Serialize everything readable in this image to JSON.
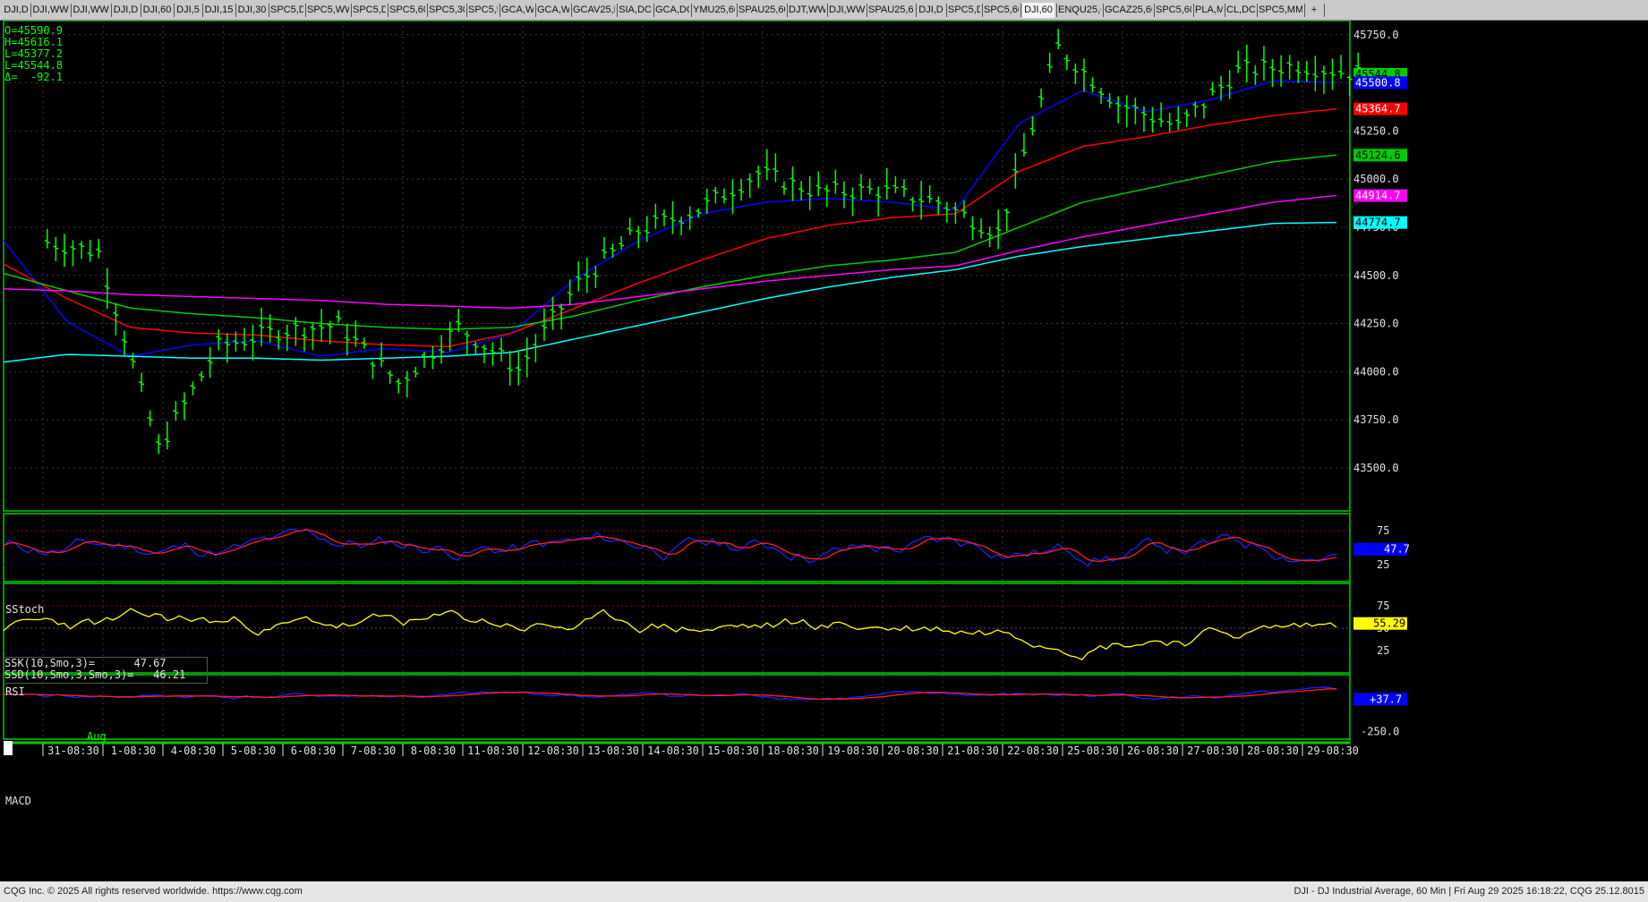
{
  "tabs": [
    {
      "label": "DJI,D"
    },
    {
      "label": "DJI,WW"
    },
    {
      "label": "DJI,WW"
    },
    {
      "label": "DJI,D"
    },
    {
      "label": "DJI,60"
    },
    {
      "label": "DJI,5"
    },
    {
      "label": "DJI,15"
    },
    {
      "label": "DJI,30"
    },
    {
      "label": "SPC5,D"
    },
    {
      "label": "SPC5,WW"
    },
    {
      "label": "SPC5,D"
    },
    {
      "label": "SPC5,60"
    },
    {
      "label": "SPC5,30"
    },
    {
      "label": "SPC5,5"
    },
    {
      "label": "GCA,W"
    },
    {
      "label": "GCA,W"
    },
    {
      "label": "GCAV25,D"
    },
    {
      "label": "SIA,DC"
    },
    {
      "label": "GCA,DC"
    },
    {
      "label": "YMU25,60"
    },
    {
      "label": "SPAU25,60"
    },
    {
      "label": "DJT,WW"
    },
    {
      "label": "DJI,WW"
    },
    {
      "label": "SPAU25,60"
    },
    {
      "label": "DJI,D"
    },
    {
      "label": "SPC5,D"
    },
    {
      "label": "SPC5,60"
    },
    {
      "label": "DJI,60",
      "active": true
    },
    {
      "label": "ENQU25,60"
    },
    {
      "label": "GCAZ25,60"
    },
    {
      "label": "SPC5,60"
    },
    {
      "label": "PLA,M"
    },
    {
      "label": "CL,DC"
    },
    {
      "label": "SPC5,MM"
    },
    {
      "label": "+"
    }
  ],
  "info": {
    "open": "O=45590.9",
    "high": "H=45616.1",
    "low": "L=45377.2",
    "last": "L=45544.8",
    "delta": "Δ=  -92.1"
  },
  "price_axis": {
    "labels": [
      "45750.0",
      "45500.0",
      "45250.0",
      "45000.0",
      "44750.0",
      "44500.0",
      "44250.0",
      "44000.0",
      "43750.0",
      "43500.0"
    ]
  },
  "price_badges": [
    {
      "text": "45544.8",
      "bg": "#00cc00",
      "fg": "#000000"
    },
    {
      "text": "45500.8",
      "bg": "#0000ff",
      "fg": "#ffffff"
    },
    {
      "text": "45364.7",
      "bg": "#ff0000",
      "fg": "#ffffff"
    },
    {
      "text": "45124.6",
      "bg": "#00cc00",
      "fg": "#000000"
    },
    {
      "text": "44914.7",
      "bg": "#ff00ff",
      "fg": "#ffffff"
    },
    {
      "text": "44774.7",
      "bg": "#00ffff",
      "fg": "#000000"
    }
  ],
  "stoch": {
    "title": "SStoch",
    "ssk": "SSK(10,Smo,3)=      47.67",
    "ssd": "SSD(10,Smo,3,Smo,3)=   46.21",
    "axis": [
      "75",
      "25"
    ],
    "badge": "47.7"
  },
  "rsi": {
    "title": "RSI",
    "axis": [
      "75",
      "50",
      "25"
    ],
    "badge": "55.29"
  },
  "macd": {
    "title": "MACD",
    "axis": [
      "-250.0"
    ],
    "badge": "+37.7"
  },
  "time_axis": {
    "month_label": "Aug",
    "labels": [
      "31-08:30",
      "1-08:30",
      "4-08:30",
      "5-08:30",
      "6-08:30",
      "7-08:30",
      "8-08:30",
      "11-08:30",
      "12-08:30",
      "13-08:30",
      "14-08:30",
      "15-08:30",
      "18-08:30",
      "19-08:30",
      "20-08:30",
      "21-08:30",
      "22-08:30",
      "25-08:30",
      "26-08:30",
      "27-08:30",
      "28-08:30",
      "29-08:30"
    ]
  },
  "footer": {
    "left": "CQG Inc. © 2025 All rights reserved worldwide. https://www.cqg.com",
    "right": "DJI - DJ Industrial Average, 60 Min | Fri Aug 29 2025 16:18:22, CQG 25.12.8015"
  },
  "colors": {
    "bars": "#00ff00",
    "ma_fast": "#0000ff",
    "ma_2": "#ff0000",
    "ma_3": "#00cc00",
    "ma_4": "#ff00ff",
    "ma_5": "#00ffff",
    "rsi": "#ffff00",
    "grid": "#3a3a3a",
    "panel_border": "#00cc00"
  },
  "chart_data": {
    "type": "line",
    "title": "",
    "xlabel": "",
    "ylabel": "",
    "ylim": [
      43300,
      45800
    ],
    "categories": [
      "31-08:30",
      "1-08:30",
      "4-08:30",
      "5-08:30",
      "6-08:30",
      "7-08:30",
      "8-08:30",
      "11-08:30",
      "12-08:30",
      "13-08:30",
      "14-08:30",
      "15-08:30",
      "18-08:30",
      "19-08:30",
      "20-08:30",
      "21-08:30",
      "22-08:30",
      "25-08:30",
      "26-08:30",
      "27-08:30",
      "28-08:30",
      "29-08:30"
    ],
    "series": [
      {
        "values": [
          44620,
          43600,
          44130,
          44210,
          44240,
          43940,
          44230,
          44010,
          44460,
          44730,
          44840,
          45030,
          44930,
          44940,
          44880,
          44720,
          45680,
          45390,
          45270,
          45560,
          45590,
          45545
        ]
      },
      {
        "values": [
          44680,
          44260,
          44080,
          44140,
          44160,
          44080,
          44120,
          44100,
          44200,
          44480,
          44680,
          44820,
          44880,
          44900,
          44880,
          44840,
          45290,
          45460,
          45350,
          45410,
          45510,
          45501
        ]
      },
      {
        "values": [
          44560,
          44380,
          44230,
          44200,
          44190,
          44160,
          44140,
          44130,
          44200,
          44330,
          44460,
          44580,
          44690,
          44760,
          44800,
          44820,
          45040,
          45170,
          45220,
          45280,
          45330,
          45365
        ]
      },
      {
        "values": [
          44510,
          44420,
          44330,
          44300,
          44280,
          44250,
          44230,
          44220,
          44230,
          44290,
          44370,
          44440,
          44500,
          44550,
          44580,
          44620,
          44750,
          44880,
          44950,
          45020,
          45090,
          45125
        ]
      },
      {
        "values": [
          44430,
          44420,
          44400,
          44390,
          44380,
          44370,
          44350,
          44340,
          44330,
          44350,
          44390,
          44430,
          44470,
          44500,
          44530,
          44550,
          44630,
          44700,
          44760,
          44820,
          44880,
          44915
        ]
      },
      {
        "values": [
          44050,
          44090,
          44080,
          44070,
          44070,
          44060,
          44070,
          44080,
          44100,
          44170,
          44240,
          44310,
          44380,
          44440,
          44490,
          44530,
          44600,
          44650,
          44690,
          44730,
          44770,
          44775
        ]
      }
    ]
  }
}
